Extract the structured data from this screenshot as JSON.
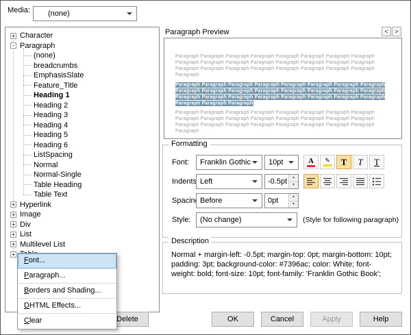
{
  "media": {
    "label": "Media:",
    "value": "(none)"
  },
  "tree": {
    "items": [
      {
        "expander": "+",
        "label": "Character"
      },
      {
        "expander": "-",
        "label": "Paragraph"
      },
      {
        "label": "(none)"
      },
      {
        "label": "breadcrumbs"
      },
      {
        "label": "EmphasisSlate"
      },
      {
        "label": "Feature_Title"
      },
      {
        "label": "Heading 1"
      },
      {
        "label": "Heading 2"
      },
      {
        "label": "Heading 3"
      },
      {
        "label": "Heading 4"
      },
      {
        "label": "Heading 5"
      },
      {
        "label": "Heading 6"
      },
      {
        "label": "ListSpacing"
      },
      {
        "label": "Normal"
      },
      {
        "label": "Normal-Single"
      },
      {
        "label": "Table Heading"
      },
      {
        "label": "Table Text"
      },
      {
        "expander": "+",
        "label": "Hyperlink"
      },
      {
        "expander": "+",
        "label": "Image"
      },
      {
        "expander": "+",
        "label": "Div"
      },
      {
        "expander": "+",
        "label": "List"
      },
      {
        "expander": "+",
        "label": "Multilevel List"
      },
      {
        "expander": "+",
        "label": "Table"
      }
    ]
  },
  "preview": {
    "title": "Paragraph Preview",
    "prev_icon": "<",
    "next_icon": ">",
    "top_lines": [
      "Paragraph Paragraph Paragraph Paragraph Paragraph Paragraph Paragraph Paragraph",
      "Paragraph Paragraph Paragraph Paragraph Paragraph Paragraph Paragraph Paragraph",
      "Paragraph Paragraph Paragraph Paragraph Paragraph Paragraph Paragraph Paragraph",
      "Paragraph"
    ],
    "highlight_lines": [
      "Paragraph Paragraph Paragraph Paragraph Paragraph Paragraph Paragraph Paragraph",
      "Paragraph Paragraph Paragraph Paragraph Paragraph Paragraph Paragraph Paragraph",
      "Paragraph Paragraph Paragraph Paragraph Paragraph Paragraph Paragraph Paragraph",
      "Paragraph Paragraph Paragraph"
    ],
    "bottom_lines": [
      "Paragraph Paragraph Paragraph Paragraph Paragraph Paragraph Paragraph Paragraph",
      "Paragraph Paragraph Paragraph Paragraph Paragraph Paragraph Paragraph Paragraph",
      "Paragraph Paragraph Paragraph Paragraph Paragraph Paragraph Paragraph Paragraph",
      "Paragraph"
    ]
  },
  "formatting": {
    "title": "Formatting",
    "font_label": "Font:",
    "font_value": "Franklin Gothic B",
    "size_value": "10pt",
    "indents_label": "Indents:",
    "indents_value": "Left",
    "indent_amount": "-0.5pt",
    "spacing_label": "Spacing:",
    "spacing_value": "Before",
    "spacing_amount": "0pt",
    "style_label": "Style:",
    "style_value": "(No change)",
    "style_note": "(Style for following paragraph)"
  },
  "toolbar_icons": {
    "font_color": "A",
    "highlight": "✎",
    "bold": "T",
    "italic": "T",
    "underline": "T"
  },
  "spinner_icons": {
    "up": "▲",
    "down": "▼"
  },
  "description": {
    "title": "Description",
    "text": "Normal + margin-left: -0.5pt; margin-top: 0pt; margin-bottom: 10pt; padding: 3pt; background-color: #7396ac; color: White; font-weight: bold; font-size: 10pt; font-family: 'Franklin Gothic Book';"
  },
  "context_menu": {
    "items": [
      {
        "first": "F",
        "rest": "ont..."
      },
      {
        "first": "P",
        "rest": "aragraph..."
      },
      {
        "first": "B",
        "rest": "orders and Shading..."
      },
      {
        "first": "D",
        "rest": "HTML Effects..."
      },
      {
        "first": "C",
        "rest": "lear"
      }
    ]
  },
  "buttons": {
    "delete": "Delete",
    "ok": "OK",
    "cancel": "Cancel",
    "apply": "Apply",
    "help": "Help"
  },
  "colors": {
    "preview_highlight": "#7396ac",
    "toggle_bg": "#fbdf9d",
    "menu_hover": "#cce4f7"
  }
}
